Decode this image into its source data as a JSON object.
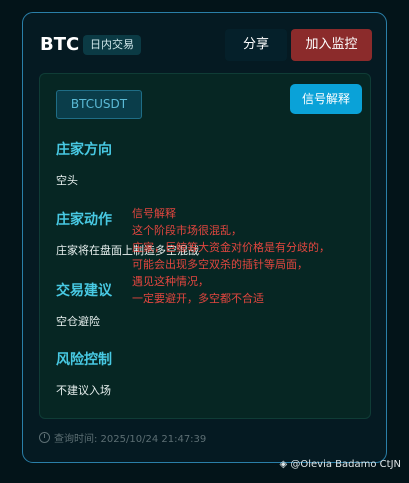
{
  "header": {
    "coin": "BTC",
    "badge": "日内交易",
    "share_label": "分享",
    "watch_label": "加入监控"
  },
  "panel": {
    "pair": "BTCUSDT",
    "signal_button": "信号解释",
    "sections": [
      {
        "title": "庄家方向",
        "text": "空头"
      },
      {
        "title": "庄家动作",
        "text": "庄家将在盘面上制造多空混战"
      },
      {
        "title": "交易建议",
        "text": "空仓避险"
      },
      {
        "title": "风险控制",
        "text": "不建议入场"
      }
    ]
  },
  "annotation": {
    "lines": [
      "信号解释",
      "这个阶段市场很混乱，",
      "庄家，巨鲸等大资金对价格是有分歧的，",
      "可能会出现多空双杀的插针等局面，",
      "遇见这种情况，",
      "一定要避开，多空都不合适"
    ]
  },
  "footer": {
    "query_time": "查询时间: 2025/10/24 21:47:39"
  },
  "watermark": "@Olevia Badamo CtJN",
  "colors": {
    "accent": "#48c9e3",
    "signal_button": "#0aa2d8",
    "watch_button": "#8b2b2b",
    "annotation": "#e2463f"
  }
}
